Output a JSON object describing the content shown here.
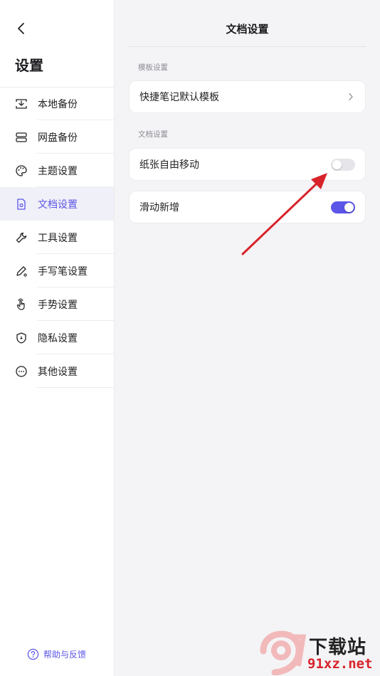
{
  "sidebar": {
    "title": "设置",
    "items": [
      {
        "label": "本地备份",
        "icon": "local-backup-icon"
      },
      {
        "label": "网盘备份",
        "icon": "cloud-backup-icon"
      },
      {
        "label": "主题设置",
        "icon": "palette-icon"
      },
      {
        "label": "文档设置",
        "icon": "document-settings-icon",
        "active": true
      },
      {
        "label": "工具设置",
        "icon": "wrench-icon"
      },
      {
        "label": "手写笔设置",
        "icon": "pen-icon"
      },
      {
        "label": "手势设置",
        "icon": "hand-gesture-icon"
      },
      {
        "label": "隐私设置",
        "icon": "shield-icon"
      },
      {
        "label": "其他设置",
        "icon": "more-icon"
      }
    ],
    "help_label": "帮助与反馈"
  },
  "main": {
    "title": "文档设置",
    "sections": [
      {
        "label": "模板设置",
        "rows": [
          {
            "label": "快捷笔记默认模板",
            "control": "chevron"
          }
        ]
      },
      {
        "label": "文档设置",
        "rows": [
          {
            "label": "纸张自由移动",
            "control": "toggle",
            "value": false
          },
          {
            "label": "滑动新增",
            "control": "toggle",
            "value": true
          }
        ]
      }
    ]
  },
  "colors": {
    "accent": "#5b55e8",
    "arrow": "#d8232a"
  },
  "watermark": {
    "cn": "下载站",
    "en": "91xz.net",
    "logo_text": "9"
  }
}
